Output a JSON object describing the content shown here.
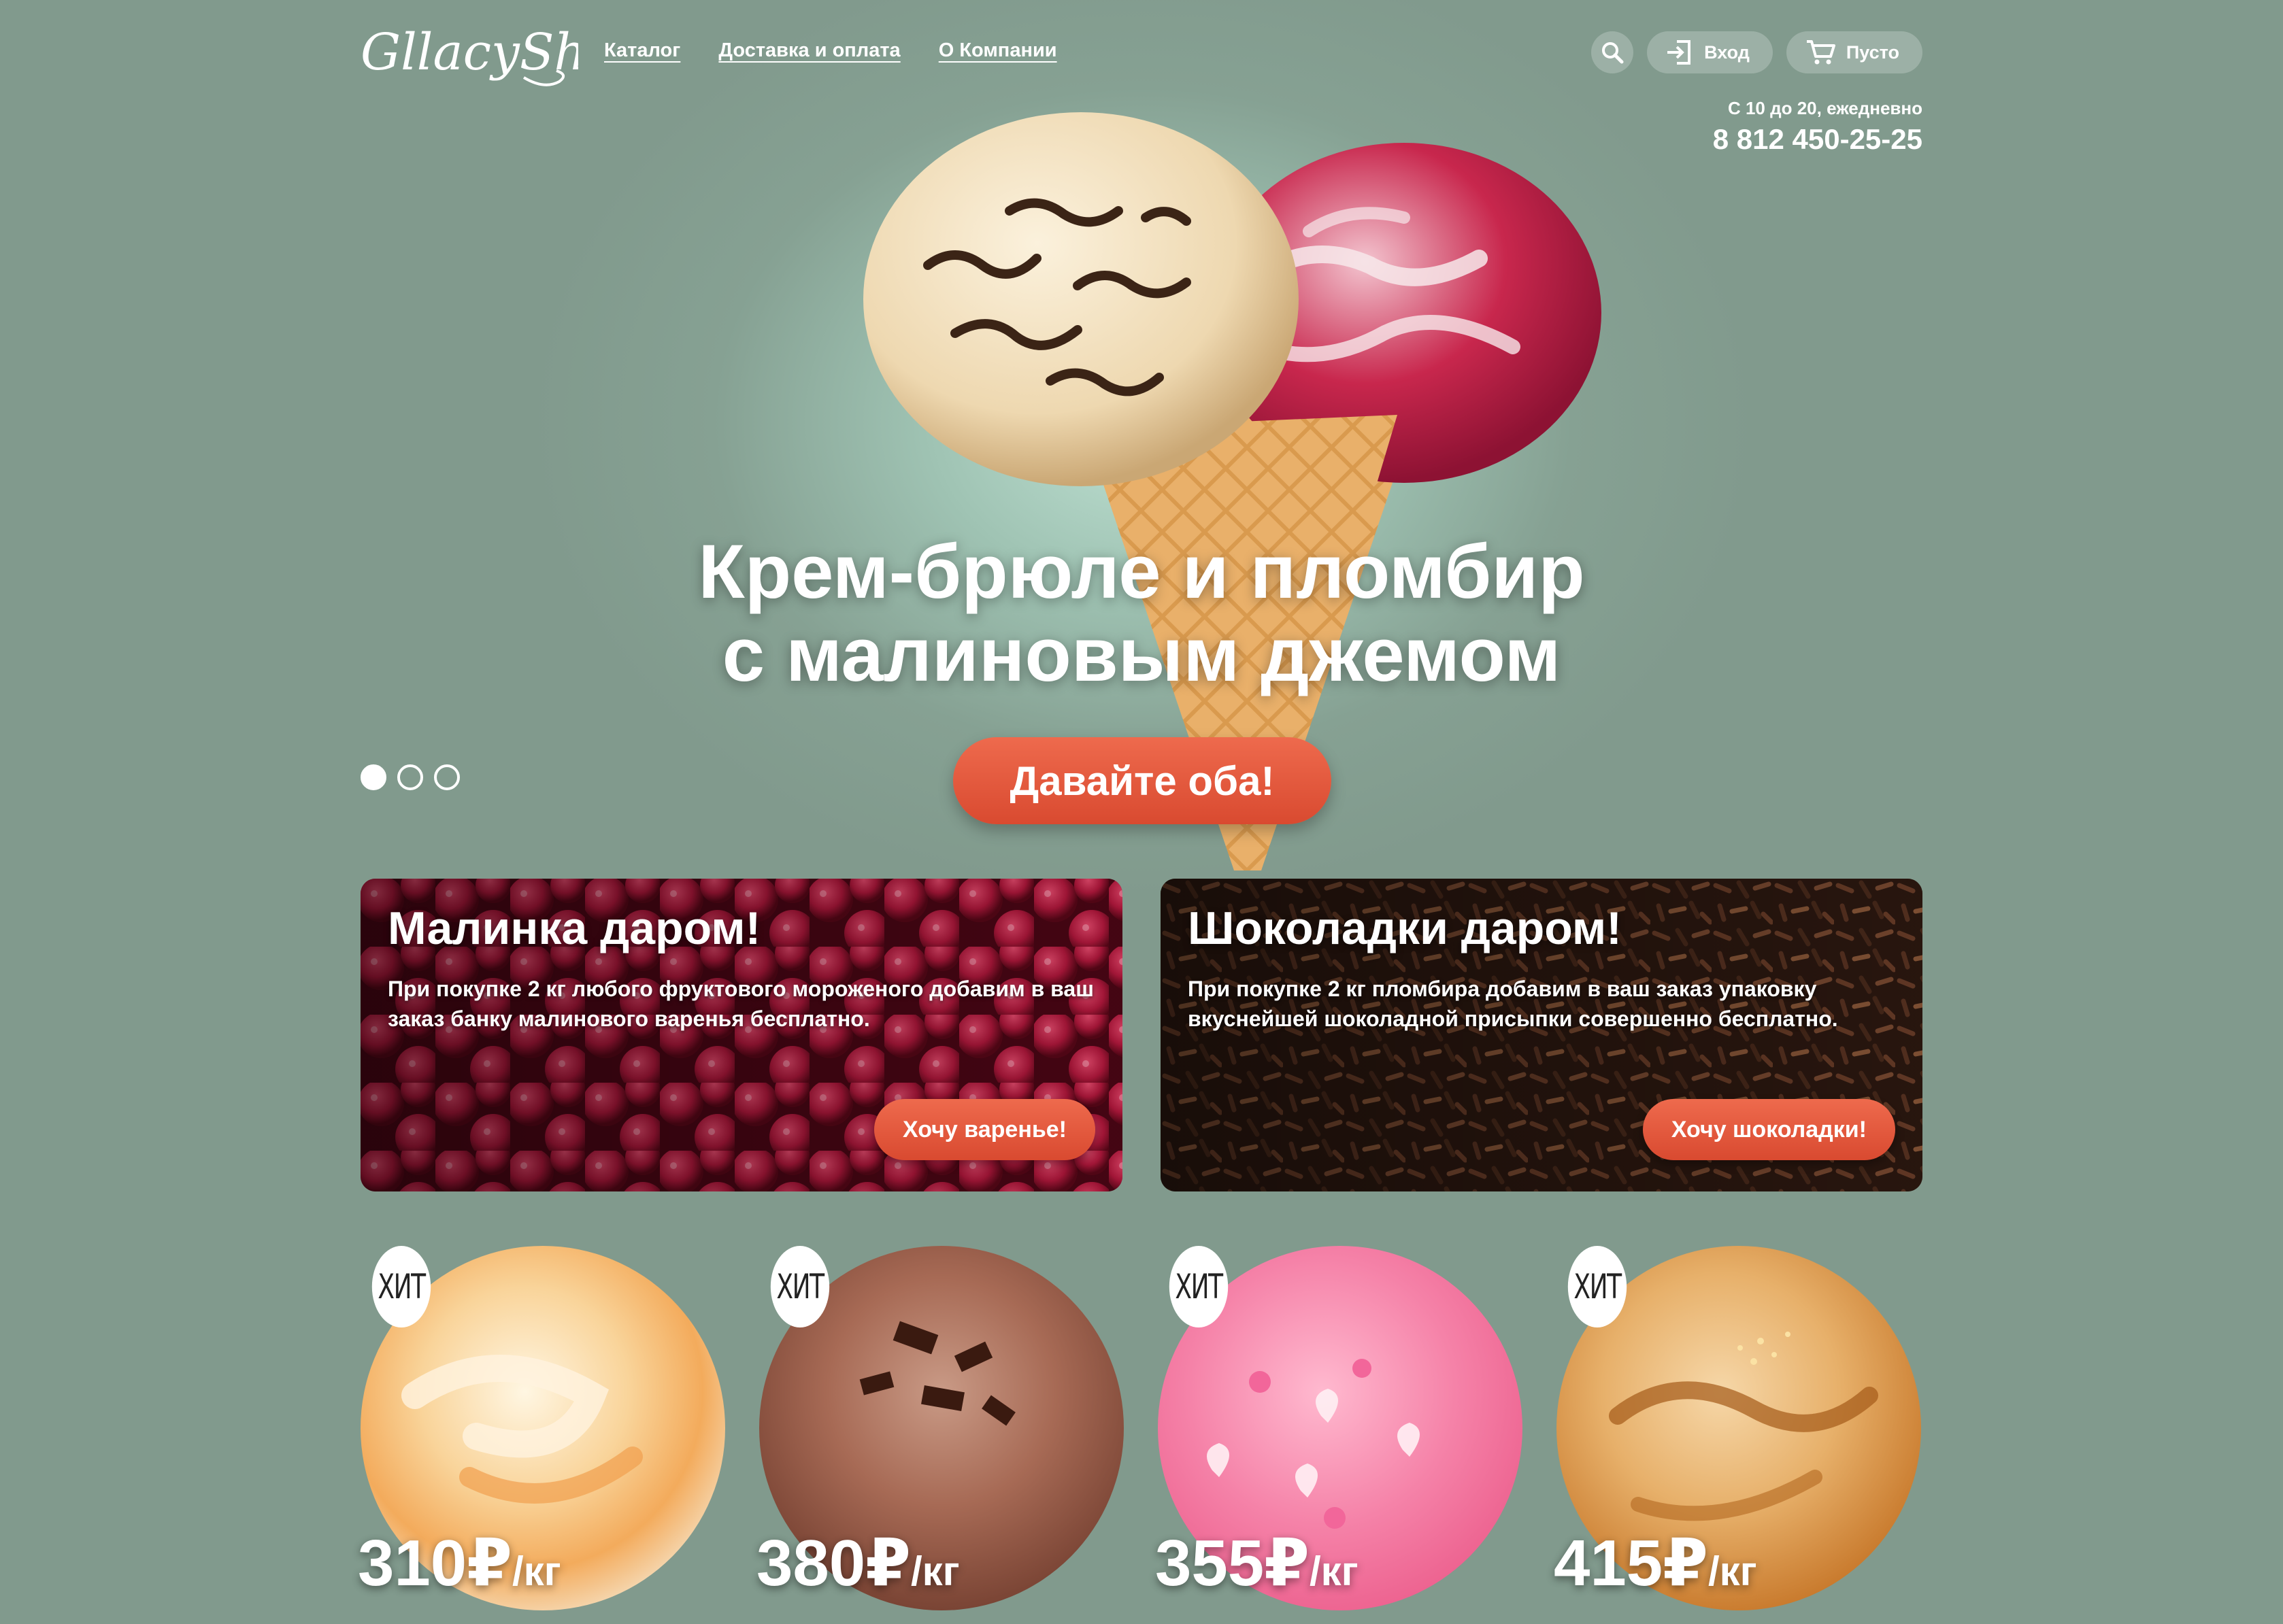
{
  "header": {
    "logo_text": "GllacyShop",
    "nav": [
      "Каталог",
      "Доставка и оплата",
      "О Компании"
    ],
    "search_icon": "search-icon",
    "login_label": "Вход",
    "cart_label": "Пусто",
    "hours": "С 10 до 20, ежедневно",
    "phone": "8 812 450-25-25"
  },
  "hero": {
    "title_line1": "Крем-брюле и пломбир",
    "title_line2": "с малиновым джемом",
    "cta_label": "Давайте оба!",
    "slides_total": 3,
    "active_slide": 1
  },
  "promos": [
    {
      "title": "Малинка даром!",
      "text": "При покупке 2 кг любого фруктового мороженого добавим в ваш заказ банку малинового варенья бесплатно.",
      "button": "Хочу варенье!"
    },
    {
      "title": "Шоколадки даром!",
      "text": "При покупке 2 кг пломбира добавим в ваш заказ упаковку вкуснейшей шоколадной присыпки совершенно бесплатно.",
      "button": "Хочу шоколадки!"
    }
  ],
  "products": [
    {
      "badge": "ХИТ",
      "price": "310",
      "currency": "₽",
      "unit": "/кг"
    },
    {
      "badge": "ХИТ",
      "price": "380",
      "currency": "₽",
      "unit": "/кг"
    },
    {
      "badge": "ХИТ",
      "price": "355",
      "currency": "₽",
      "unit": "/кг"
    },
    {
      "badge": "ХИТ",
      "price": "415",
      "currency": "₽",
      "unit": "/кг"
    }
  ],
  "colors": {
    "background": "#819a8d",
    "accent_button": "#e2563b",
    "text": "#ffffff"
  }
}
